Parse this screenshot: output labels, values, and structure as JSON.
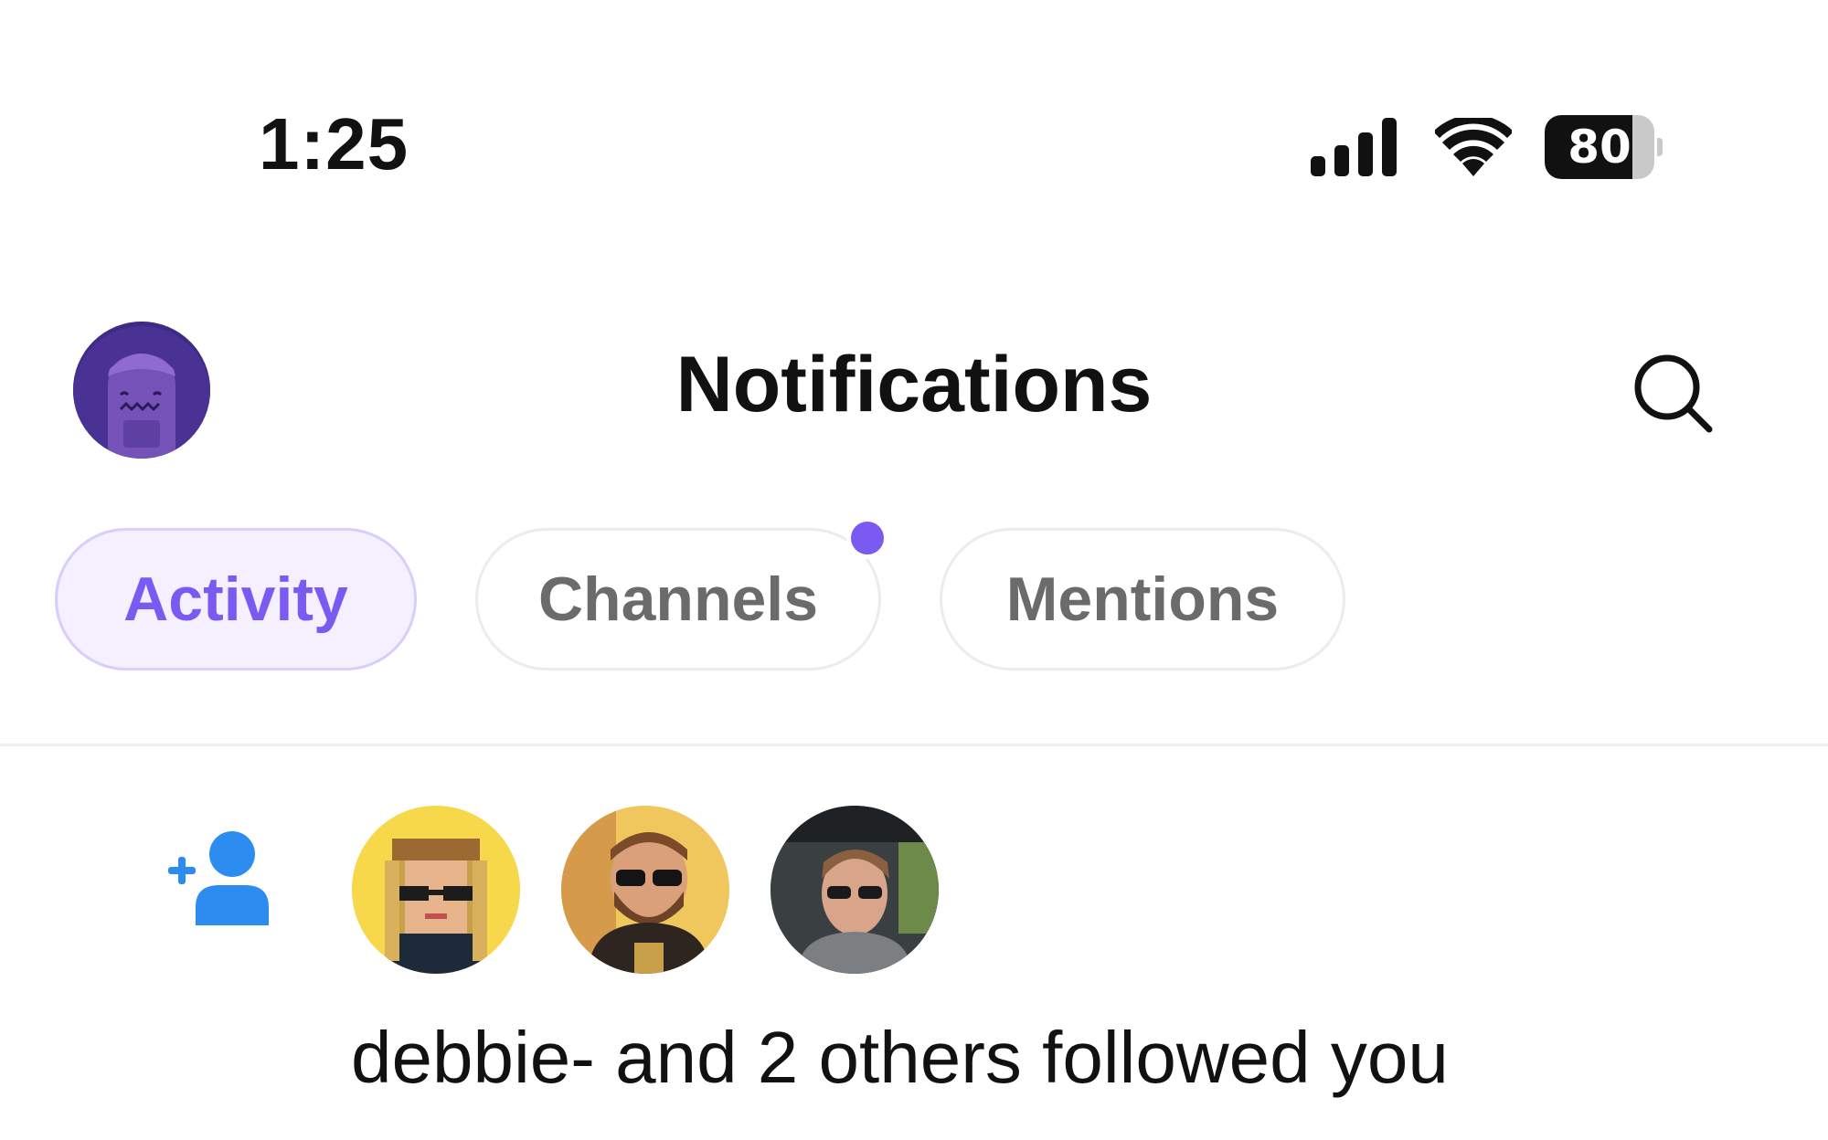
{
  "status_bar": {
    "time": "1:25",
    "battery_level": "80",
    "battery_fraction": 0.8,
    "signal_icon": "cellular-signal-icon",
    "wifi_icon": "wifi-icon"
  },
  "header": {
    "title": "Notifications",
    "profile_icon": "profile-avatar",
    "search_icon": "search-icon"
  },
  "tabs": [
    {
      "label": "Activity",
      "active": true
    },
    {
      "label": "Channels",
      "active": false,
      "has_unread": true
    },
    {
      "label": "Mentions",
      "active": false
    }
  ],
  "notifications": [
    {
      "type_icon": "add-user-icon",
      "avatars": [
        "avatar-pixel-art-woman",
        "avatar-bearded-man",
        "avatar-man-in-car"
      ],
      "text": "debbie- and 2 others followed you"
    }
  ],
  "colors": {
    "accent": "#7a5af0",
    "active_tab_bg": "#f4f0ff",
    "follow_icon": "#2d8cf0"
  }
}
